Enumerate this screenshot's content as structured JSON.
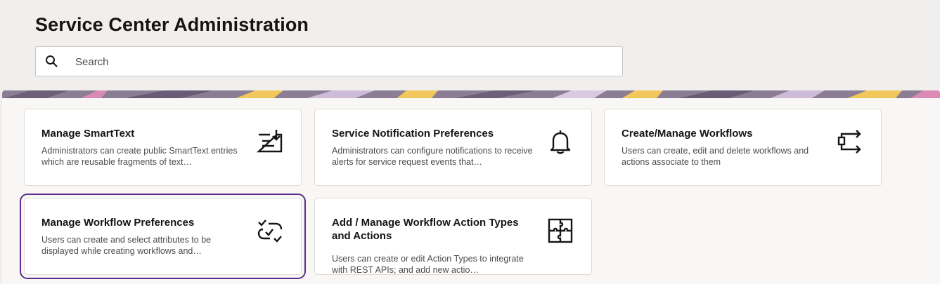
{
  "page": {
    "title": "Service Center Administration"
  },
  "search": {
    "placeholder": "Search",
    "value": ""
  },
  "cards": [
    {
      "title": "Manage SmartText",
      "description": "Administrators can create public SmartText entries which are reusable fragments of text…",
      "icon": "text-download-icon"
    },
    {
      "title": "Service Notification Preferences",
      "description": "Administrators can configure notifications to receive alerts for service request events that…",
      "icon": "bell-icon"
    },
    {
      "title": "Create/Manage Workflows",
      "description": "Users can create, edit and delete workflows and actions associate to them",
      "icon": "workflow-arrows-icon"
    },
    {
      "title": "Manage Workflow Preferences",
      "description": "Users can create and select attributes to be displayed while creating workflows and…",
      "icon": "check-loop-icon",
      "selected": true
    },
    {
      "title": "Add / Manage Workflow Action Types and Actions",
      "description": "Users can create or edit Action Types to integrate with REST APIs; and add new actio…",
      "icon": "puzzle-icon"
    }
  ],
  "colors": {
    "selected_outline": "#5d2e8c",
    "background": "#f1efed"
  }
}
